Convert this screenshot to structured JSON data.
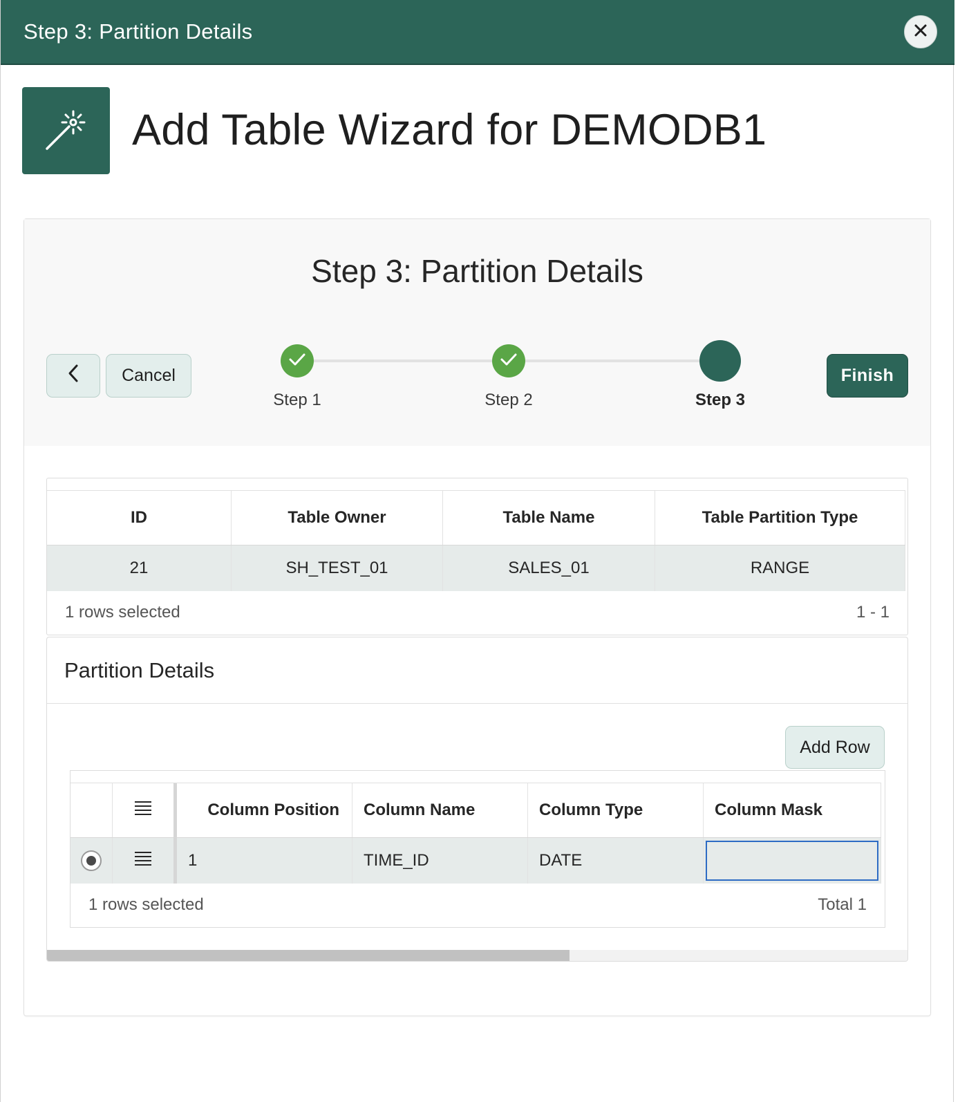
{
  "dialog": {
    "title": "Step 3: Partition Details",
    "close_icon": "close-icon"
  },
  "hero": {
    "icon": "magic-wand-icon",
    "title": "Add Table Wizard for DEMODB1"
  },
  "wizard": {
    "heading": "Step 3: Partition Details",
    "back_icon": "chevron-left-icon",
    "cancel_label": "Cancel",
    "finish_label": "Finish",
    "steps": [
      {
        "label": "Step 1",
        "state": "complete"
      },
      {
        "label": "Step 2",
        "state": "complete"
      },
      {
        "label": "Step 3",
        "state": "current"
      }
    ],
    "colors": {
      "accent": "#2c6558",
      "complete": "#5aa646"
    }
  },
  "table_grid": {
    "columns": [
      "ID",
      "Table Owner",
      "Table Name",
      "Table Partition Type"
    ],
    "rows": [
      {
        "id": "21",
        "owner": "SH_TEST_01",
        "name": "SALES_01",
        "partition_type": "RANGE"
      }
    ],
    "footer_left": "1 rows selected",
    "footer_right": "1 - 1"
  },
  "partition_details": {
    "title": "Partition Details",
    "add_row_label": "Add Row",
    "columns": [
      "Column Position",
      "Column Name",
      "Column Type",
      "Column Mask"
    ],
    "rows": [
      {
        "position": "1",
        "name": "TIME_ID",
        "type": "DATE",
        "mask": ""
      }
    ],
    "footer_left": "1 rows selected",
    "footer_right": "Total 1"
  }
}
